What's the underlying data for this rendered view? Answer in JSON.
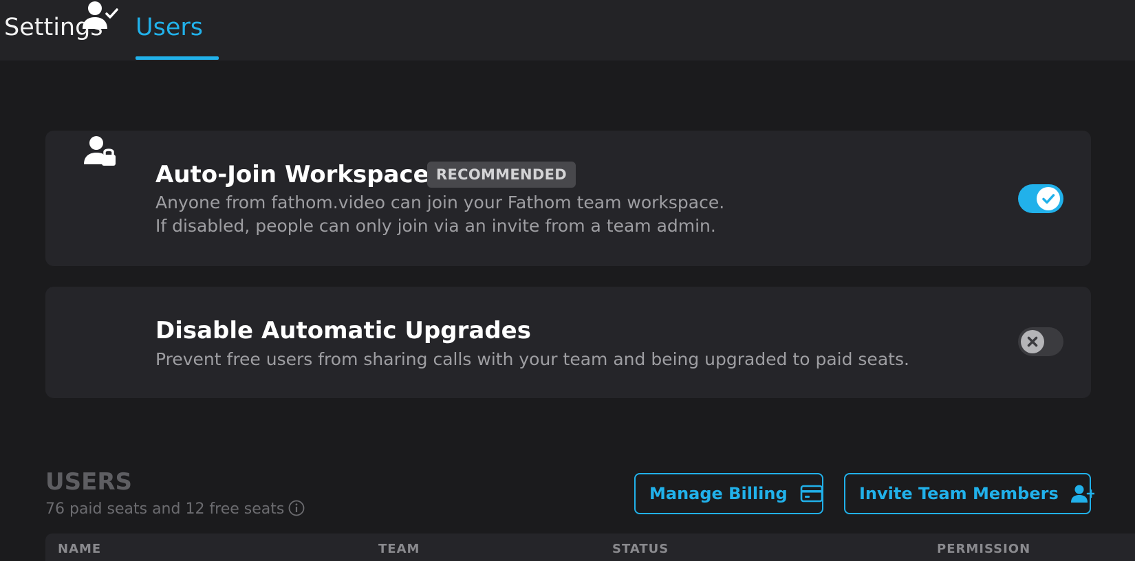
{
  "tabs": [
    {
      "label": "Settings",
      "active": false
    },
    {
      "label": "Users",
      "active": true
    }
  ],
  "accent_color": "#21b1ea",
  "settings": {
    "auto_join": {
      "title": "Auto-Join Workspace",
      "badge": "RECOMMENDED",
      "description_line1": "Anyone from fathom.video can join your Fathom team workspace.",
      "description_line2": "If disabled, people can only join via an invite from a team admin.",
      "enabled": true,
      "icon": "user-check-icon"
    },
    "disable_upgrades": {
      "title": "Disable Automatic Upgrades",
      "description": "Prevent free users from sharing calls with your team and being upgraded to paid seats.",
      "enabled": false,
      "icon": "user-lock-icon"
    }
  },
  "users_section": {
    "title": "USERS",
    "subtitle": "76 paid seats and 12 free seats",
    "buttons": {
      "manage_billing": "Manage Billing",
      "invite_members": "Invite Team Members"
    },
    "table_columns": [
      "NAME",
      "TEAM",
      "STATUS",
      "PERMISSION"
    ]
  }
}
